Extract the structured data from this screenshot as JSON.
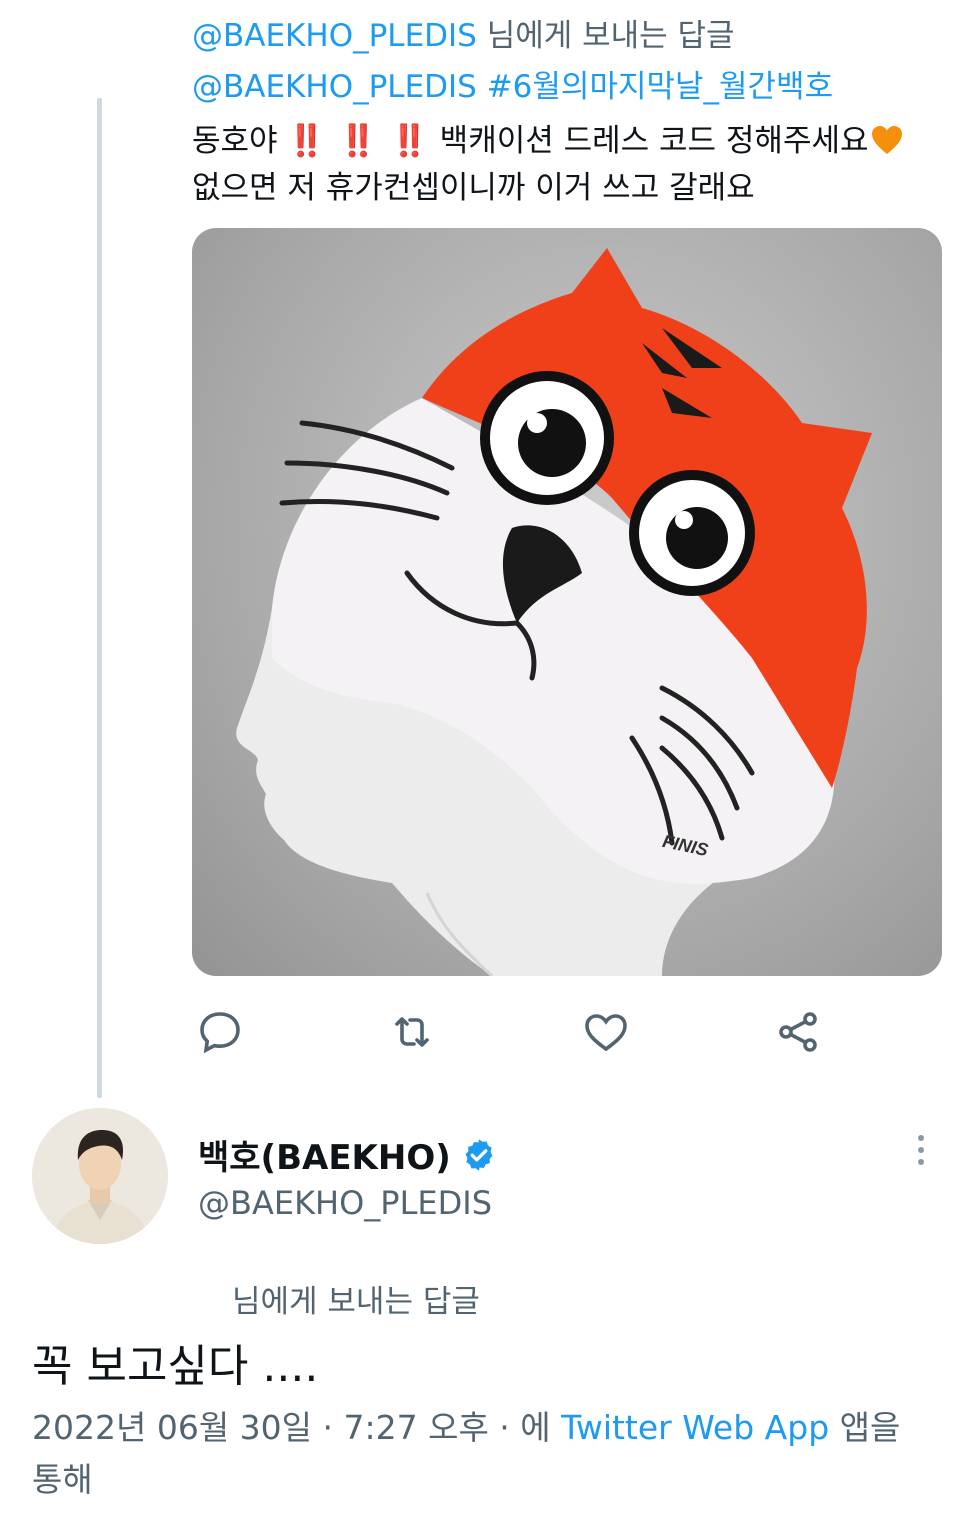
{
  "parent_tweet": {
    "reply_handle": "@BAEKHO_PLEDIS",
    "reply_suffix": "님에게 보내는 답글",
    "handle_mention": "@BAEKHO_PLEDIS",
    "hashtag": "#6월의마지막날_월간백호",
    "line2_start": "동호야",
    "line2_bangs": "‼️ ‼️ ‼️",
    "line2_end": "백캐이션 드레스 코드 정해주세요",
    "line3": "없으면 저 휴가컨셉이니까 이거 쓰고 갈래요",
    "media_brand": "FINIS"
  },
  "actions": [
    "reply-icon",
    "retweet-icon",
    "like-icon",
    "share-icon"
  ],
  "main_tweet": {
    "display_name": "백호(BAEKHO)",
    "handle": "@BAEKHO_PLEDIS",
    "replying_label": "님에게 보내는 답글",
    "text": "꼭 보고싶다 ....",
    "timestamp": "2022년 06월 30일 · 7:27 오후 · 에 ",
    "source_app": "Twitter Web App",
    "source_suffix": " 앱을 통해"
  },
  "colors": {
    "link": "#1d9bf0",
    "secondary": "#536471",
    "thread_line": "#cfd9de",
    "tiger_orange": "#f0401a"
  }
}
